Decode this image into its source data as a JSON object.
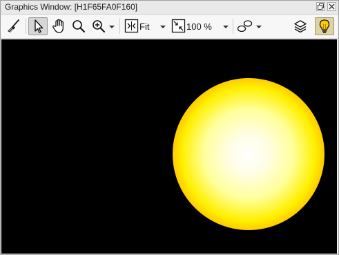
{
  "window": {
    "title": "Graphics Window: [H1F65FA0F160]"
  },
  "titlebar_buttons": [
    {
      "name": "restore",
      "icon": "restore-icon"
    },
    {
      "name": "close",
      "icon": "close-icon"
    }
  ],
  "toolbar": {
    "zoom_mode_label": "Fit",
    "zoom_percent_label": "100 %"
  },
  "colors": {
    "canvas_background": "#000000",
    "sun_center": "#ffffff",
    "sun_mid": "#ffff00",
    "sun_edge": "#ff1e00"
  }
}
